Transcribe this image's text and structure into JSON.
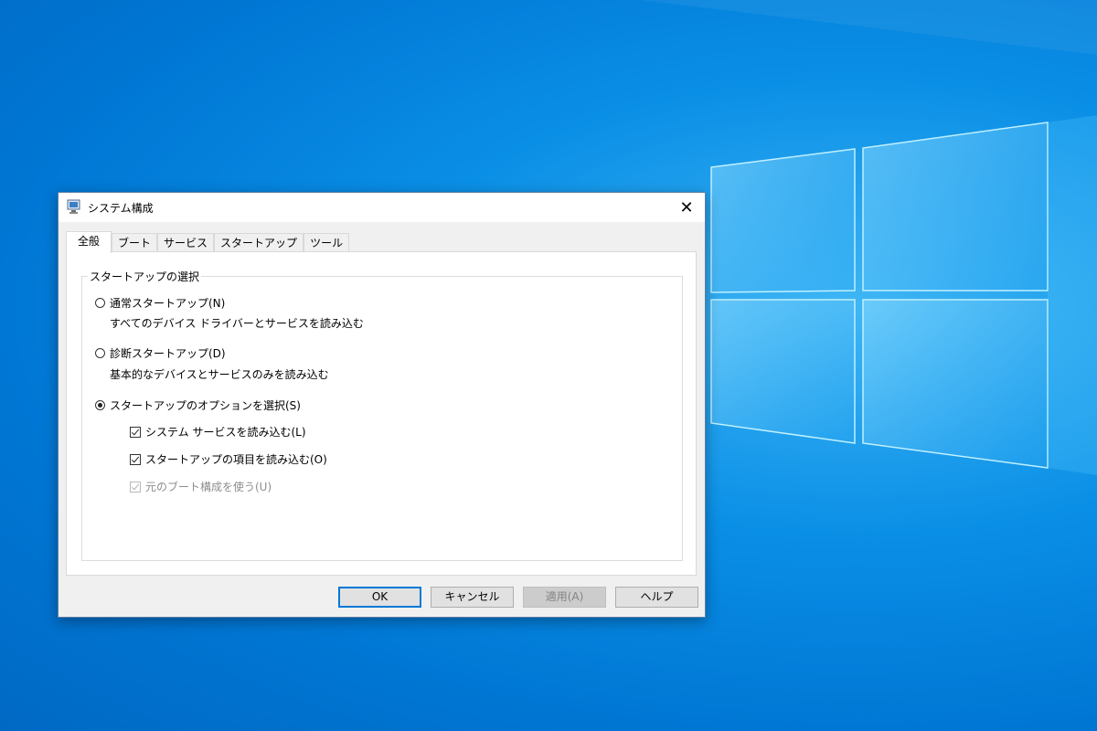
{
  "window": {
    "title": "システム構成",
    "close_icon": "close-icon",
    "app_icon": "msconfig-icon"
  },
  "tabs": [
    {
      "label": "全般",
      "active": true
    },
    {
      "label": "ブート"
    },
    {
      "label": "サービス"
    },
    {
      "label": "スタートアップ"
    },
    {
      "label": "ツール"
    }
  ],
  "startup_group": {
    "legend": "スタートアップの選択",
    "normal": {
      "label": "通常スタートアップ(N)",
      "description": "すべてのデバイス ドライバーとサービスを読み込む",
      "selected": false
    },
    "diagnostic": {
      "label": "診断スタートアップ(D)",
      "description": "基本的なデバイスとサービスのみを読み込む",
      "selected": false
    },
    "selective": {
      "label": "スタートアップのオプションを選択(S)",
      "selected": true
    },
    "load_services": {
      "label": "システム サービスを読み込む(L)",
      "checked": true
    },
    "load_startup_items": {
      "label": "スタートアップの項目を読み込む(O)",
      "checked": true
    },
    "use_original_boot": {
      "label": "元のブート構成を使う(U)",
      "checked": true,
      "enabled": false
    }
  },
  "buttons": {
    "ok": "OK",
    "cancel": "キャンセル",
    "apply": "適用(A)",
    "help": "ヘルプ"
  },
  "colors": {
    "desktop": "#0a8fe6",
    "accent": "#0078d7"
  }
}
